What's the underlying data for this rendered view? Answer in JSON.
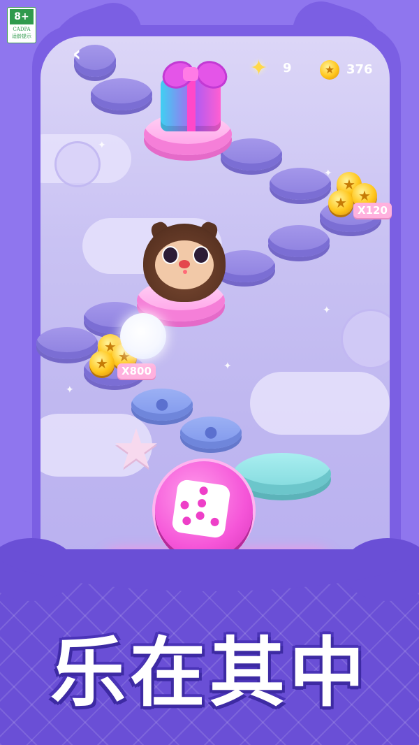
{
  "age_rating": {
    "age": "8+",
    "org": "CADPA",
    "tip": "适龄提示"
  },
  "hud": {
    "back_icon": "chevron-left-icon",
    "star_count": "9",
    "coin_count": "376"
  },
  "rewards": {
    "left_multiplier": "X800",
    "right_multiplier": "X120"
  },
  "banner": {
    "slogan": "乐在其中"
  },
  "colors": {
    "background": "#8f76ee",
    "frame": "#7b5fe3",
    "dice_pink": "#f555d8",
    "coin_gold": "#ffc61c",
    "banner": "#6a4fd6"
  }
}
